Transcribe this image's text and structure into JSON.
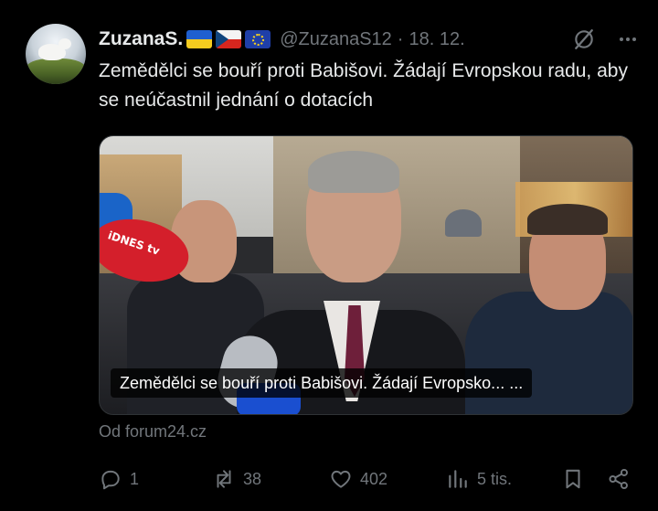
{
  "author": {
    "name": "ZuzanaS.",
    "flags": [
      "ukraine-flag",
      "czech-flag",
      "eu-flag"
    ],
    "handle": "@ZuzanaS12",
    "separator": "·",
    "date": "18. 12."
  },
  "post": {
    "text": "Zemědělci se bouří proti Babišovi. Žádají Evropskou radu, aby se neúčastnil jednání o dotacích"
  },
  "card": {
    "caption": "Zemědělci se bouří proti Babišovi. Žádají Evropsko... ...",
    "mic_logo": "iDNES tv",
    "source": "Od forum24.cz"
  },
  "actions": {
    "replies": "1",
    "reposts": "38",
    "likes": "402",
    "views": "5 tis."
  },
  "colors": {
    "background": "#000000",
    "text_primary": "#e7e9ea",
    "text_secondary": "#71767b",
    "border": "#2f3336"
  }
}
